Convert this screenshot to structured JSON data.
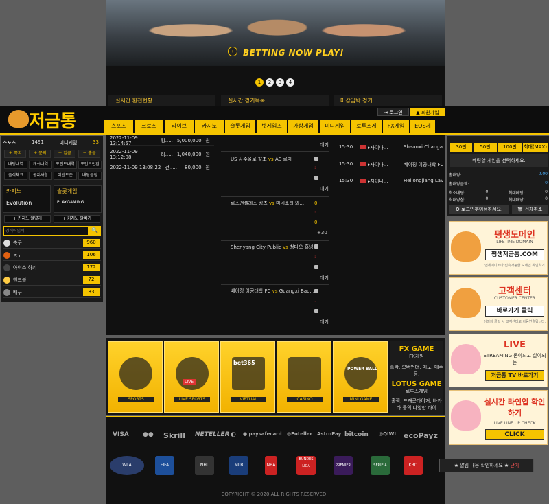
{
  "banner": {
    "slogan": "BETTING NOW PLAY!",
    "play": "›",
    "pages": [
      "1",
      "2",
      "3",
      "4"
    ]
  },
  "tabs": [
    "실시간 환전현황",
    "실시간 경기목록",
    "마감임박 경기"
  ],
  "auth": {
    "login": "로그인",
    "join": "회원가입",
    "login_icon": "⇥",
    "join_icon": "▲"
  },
  "logo": "저금통",
  "nav": [
    "스포츠",
    "크로스",
    "라이브",
    "카지노",
    "슬롯게임",
    "벳게임즈",
    "가상게임",
    "미니게임",
    "로투스게임",
    "FX게임",
    "EOS게임"
  ],
  "left": {
    "stats": [
      {
        "k": "스포츠",
        "v": "1491"
      },
      {
        "k": "미니게임",
        "v": "33"
      }
    ],
    "btns": [
      "＋ 쪽지",
      "＋ 문의",
      "＋ 입금",
      "－ 출금"
    ],
    "menu": [
      "배팅내역",
      "캐쉬내역",
      "포인트내역",
      "포인트전환",
      "출석체크",
      "공지사항",
      "이벤트존",
      "배당금정"
    ],
    "casino": {
      "t1": "카지노",
      "t2": "슬롯게임",
      "brand": "Evolution",
      "brand2": "PLAYGAMING"
    },
    "casino_btns": [
      "+ 카지노 알넣기",
      "+ 카지노 알빼기"
    ],
    "search_ph": "경색어입력",
    "search_btn": "🔍",
    "sports": [
      {
        "n": "축구",
        "c": "960",
        "col": "#ddd"
      },
      {
        "n": "농구",
        "c": "106",
        "col": "#e06010"
      },
      {
        "n": "아이스 하키",
        "c": "172",
        "col": "#444"
      },
      {
        "n": "핸드볼",
        "c": "72",
        "col": "#ffcc44"
      },
      {
        "n": "배구",
        "c": "83",
        "col": "#888"
      }
    ]
  },
  "history": [
    {
      "d": "2022-11-09 13:14:57",
      "u": "킹.....",
      "a": "5,000,000",
      "w": "원"
    },
    {
      "d": "2022-11-09 13:12:08",
      "u": "라.....",
      "a": "1,040,000",
      "w": "원"
    },
    {
      "d": "2022-11-09 13:08:22",
      "u": "건.....",
      "a": "80,000",
      "w": "원"
    }
  ],
  "matches": [
    {
      "h": "US 사수올로 칼초",
      "vs": "vs",
      "a": "AS 로마"
    },
    {
      "h": "로스앤젤레스 킹즈",
      "vs": "vs",
      "a": "미네소타 와..."
    },
    {
      "h": "Shenyang City Public",
      "vs": "vs",
      "a": "청다오 홍넝"
    },
    {
      "h": "베이징 이공대학 FC",
      "vs": "vs",
      "a": "Guangxi Bao..."
    }
  ],
  "mid": {
    "dae": "대기",
    "odd0": "0",
    "plus": "+30",
    "sep": ":"
  },
  "right_list": [
    {
      "t": "15:30",
      "h": "▸자이나...",
      "a": "Shaanxi Changan Al"
    },
    {
      "t": "15:30",
      "h": "▸자이나...",
      "a": "베이징 이공대학 FC"
    },
    {
      "t": "15:30",
      "h": "▸자이나...",
      "a": "Heilongjiang Lava S"
    }
  ],
  "cart": {
    "amts": [
      "30만",
      "50만",
      "100만",
      "최대(MAX)"
    ],
    "msg": "베팅할 게임을 선택하세요.",
    "rows": [
      {
        "k": "총배당:",
        "v": "0.00"
      },
      {
        "k": "총배당금액:",
        "v": "0"
      },
      {
        "k": "최소베팅:",
        "v": "0",
        "k2": "최대베팅:",
        "v2": "0"
      },
      {
        "k": "최대당첨:",
        "v": "0",
        "k2": "최대배당:",
        "v2": "0"
      }
    ],
    "login": "⚙ 로그인후이용하세요.",
    "clear": "🗑 전체취소"
  },
  "ads": [
    {
      "t1": "평생도메인",
      "t2": "LIFETIME DOMAIN",
      "t3": "평생저금통.COM",
      "t4": "언제어디서나 접속가능한 도메인 확인하기"
    },
    {
      "t1": "고객센터",
      "t2": "CUSTOMER CENTER",
      "t3": "바로가기 클릭",
      "t4": "이미지 클릭 시 고객센터로 자동연결됩니다."
    },
    {
      "t1": "LIVE",
      "t2": "STREAMING 돈이되고 살이되는",
      "t3": "저금통 TV 바로가기",
      "t4": ""
    },
    {
      "t1": "실시간 라인업 확인하기",
      "t2": "LIVE LINE UP CHECK",
      "t3": "CLICK",
      "t4": ""
    }
  ],
  "cards": [
    {
      "l": "SPORTS"
    },
    {
      "l": "LIVE SPORTS"
    },
    {
      "l": "VIRTUAL"
    },
    {
      "l": "CASINO"
    },
    {
      "l": "MINI GAME"
    }
  ],
  "cards_extra": {
    "live": "LIVE",
    "bet365": "bet365",
    "power": "POWER BALL"
  },
  "fx": {
    "t1": "FX GAME",
    "s1": "FX게임",
    "d1": "홀짝, 오버언더, 매도, 매수등.",
    "t2": "LOTUS GAME",
    "s2": "로투스게임",
    "d2": "홀짝, 드래곤타이거, 바카라 등의 다양한 라이"
  },
  "pays": [
    "VISA",
    "●●",
    "Skrill",
    "NETELLER",
    "◐",
    "● paysafecard",
    "◎Euteller",
    "AstroPay",
    "bitcoin",
    "◎QIWI",
    "ecoPayz"
  ],
  "leagues": [
    "WLA",
    "FIFA",
    "NHL",
    "MLB",
    "NBA",
    "BUNDES LIGA",
    "PREMIER",
    "SERIE A",
    "KBO"
  ],
  "copyright": "COPYRIGHT © 2020 ALL RIGHTS RESERVED.",
  "popup": "★ 알림 내용 확인하세요 ★",
  "popup_close": "닫기"
}
